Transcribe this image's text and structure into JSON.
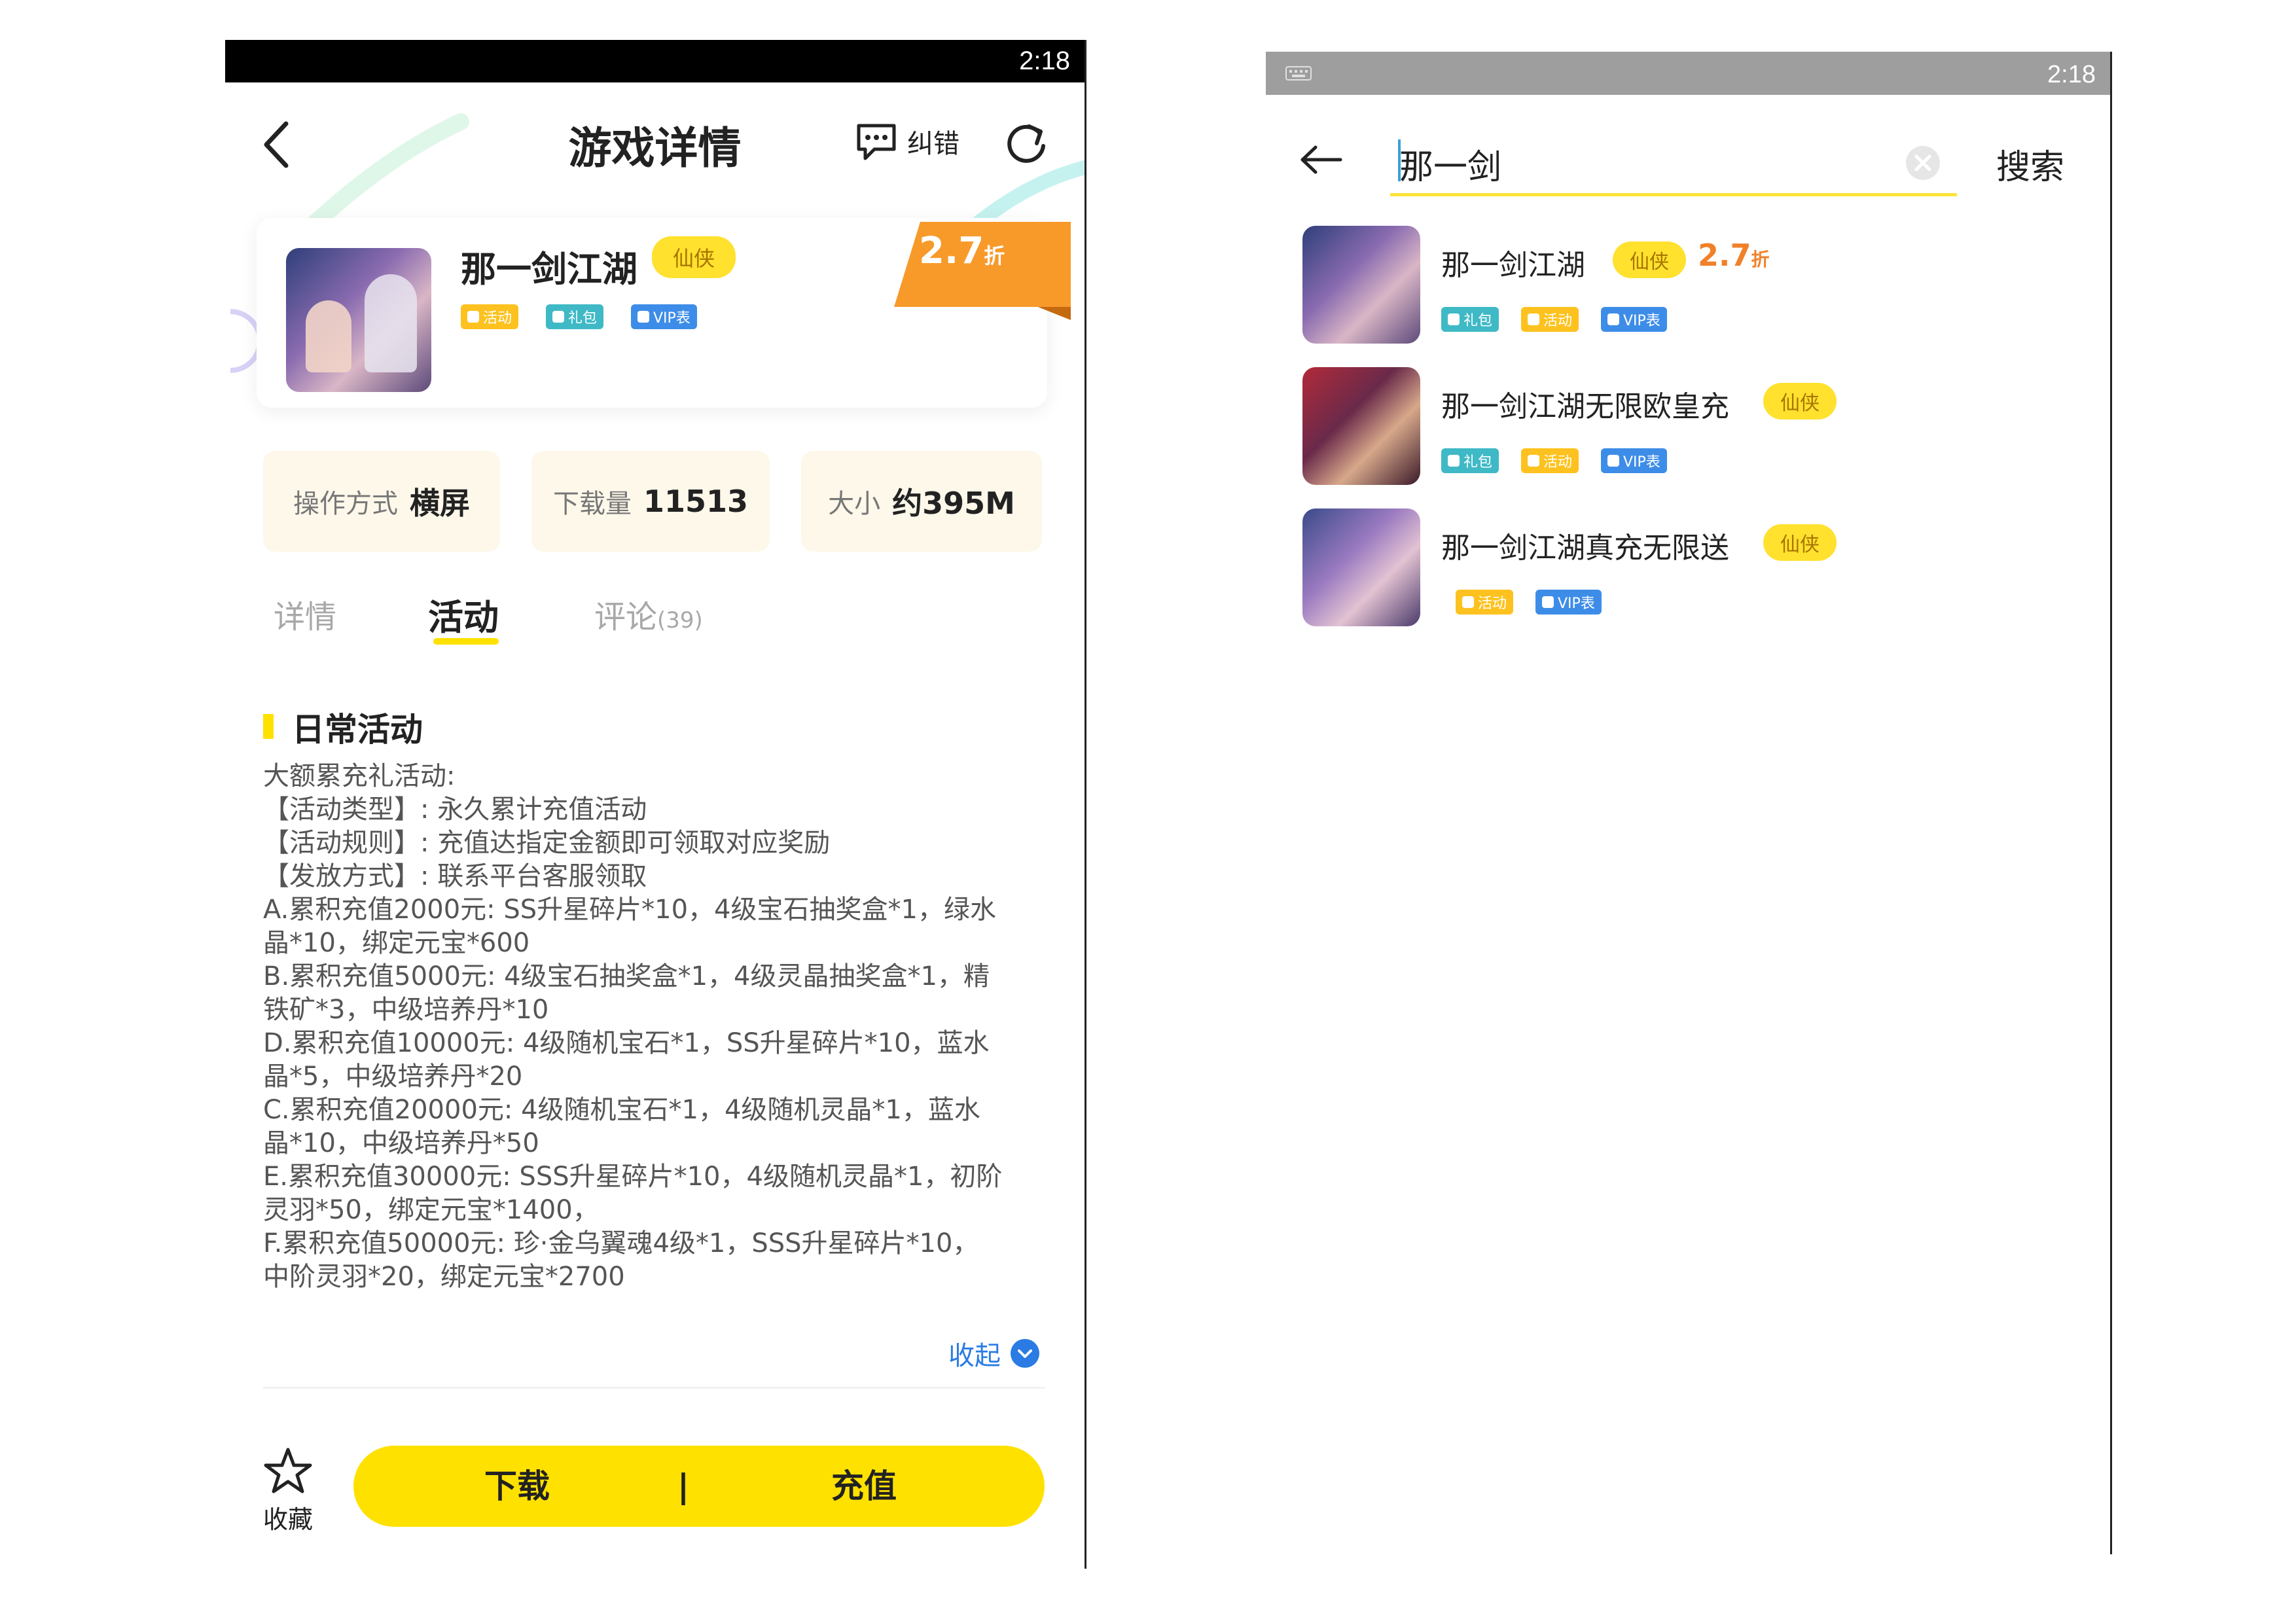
{
  "status_bar": {
    "time": "2:18"
  },
  "detail": {
    "header": {
      "title": "游戏详情",
      "report_label": "纠错"
    },
    "game": {
      "name": "那一剑江湖",
      "genre": "仙侠",
      "discount_value": "2.7",
      "discount_unit": "折",
      "tags": [
        "活动",
        "礼包",
        "VIP表"
      ]
    },
    "stats": [
      {
        "label": "操作方式",
        "value": "横屏"
      },
      {
        "label": "下载量",
        "value": "11513"
      },
      {
        "label": "大小",
        "value": "约395M"
      }
    ],
    "tabs": {
      "details": "详情",
      "activity": "活动",
      "comments": "评论",
      "comments_count": "(39)"
    },
    "section_title": "日常活动",
    "activity_lines": [
      "大额累充礼活动:",
      "【活动类型】: 永久累计充值活动",
      "【活动规则】: 充值达指定金额即可领取对应奖励",
      "【发放方式】: 联系平台客服领取",
      "A.累积充值2000元: SS升星碎片*10，4级宝石抽奖盒*1，绿水",
      "晶*10，绑定元宝*600",
      "B.累积充值5000元: 4级宝石抽奖盒*1，4级灵晶抽奖盒*1，精",
      "铁矿*3，中级培养丹*10",
      "D.累积充值10000元: 4级随机宝石*1，SS升星碎片*10，蓝水",
      "晶*5，中级培养丹*20",
      "C.累积充值20000元: 4级随机宝石*1，4级随机灵晶*1，蓝水",
      "晶*10，中级培养丹*50",
      "E.累积充值30000元: SSS升星碎片*10，4级随机灵晶*1，初阶",
      "灵羽*50，绑定元宝*1400，",
      "F.累积充值50000元: 珍·金乌翼魂4级*1，SSS升星碎片*10，",
      "中阶灵羽*20，绑定元宝*2700"
    ],
    "collapse_label": "收起",
    "bottom": {
      "favorite_label": "收藏",
      "download_label": "下载",
      "separator": "|",
      "recharge_label": "充值"
    }
  },
  "search": {
    "query": "那一剑",
    "search_button": "搜索",
    "results": [
      {
        "name": "那一剑江湖",
        "genre": "仙侠",
        "discount_value": "2.7",
        "discount_unit": "折",
        "tags": [
          "礼包",
          "活动",
          "VIP表"
        ]
      },
      {
        "name": "那一剑江湖无限欧皇充",
        "genre": "仙侠",
        "tags": [
          "礼包",
          "活动",
          "VIP表"
        ]
      },
      {
        "name": "那一剑江湖真充无限送",
        "genre": "仙侠",
        "tags": [
          "活动",
          "VIP表"
        ]
      }
    ]
  },
  "colors": {
    "accent_yellow": "#ffe100",
    "discount_orange": "#f79a2a",
    "tag_yellow": "#fdc21f",
    "tag_teal": "#3fb9c6",
    "tag_blue": "#3d8de8",
    "link_blue": "#2a7be4"
  }
}
